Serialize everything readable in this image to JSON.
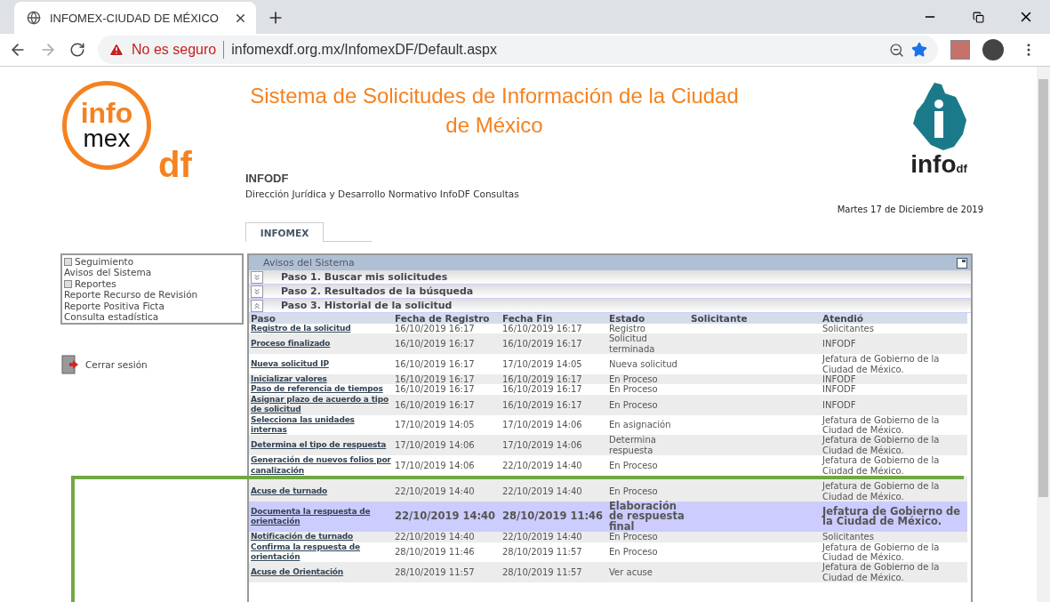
{
  "browser": {
    "tab_title": "INFOMEX-CIUDAD DE MÉXICO",
    "security_label": "No es seguro",
    "url": "infomexdf.org.mx/InfomexDF/Default.aspx"
  },
  "header": {
    "logo_left": {
      "top": "info",
      "middle": "mex",
      "bottom": "df"
    },
    "title": "Sistema de Solicitudes de Información de la Ciudad de México",
    "org": "INFODF",
    "department": "Dirección Jurídica y Desarrollo Normativo InfoDF Consultas",
    "logo_right": {
      "word": "info",
      "suffix": "df"
    },
    "date": "Martes 17 de Diciembre de 2019"
  },
  "tabs": [
    {
      "label": "INFOMEX",
      "selected": true
    }
  ],
  "sidebar": {
    "items": [
      {
        "label": "Seguimiento",
        "kind": "group"
      },
      {
        "label": "Avisos del Sistema",
        "kind": "link"
      },
      {
        "label": "Reportes",
        "kind": "group"
      },
      {
        "label": "Reporte Recurso de Revisión",
        "kind": "link"
      },
      {
        "label": "Reporte Positiva Ficta",
        "kind": "link"
      },
      {
        "label": "Consulta estadística",
        "kind": "link"
      }
    ],
    "logout": "Cerrar sesión"
  },
  "panel": {
    "title": "Avisos del Sistema",
    "steps": [
      {
        "label": "Paso 1. Buscar mis solicitudes",
        "expanded": false
      },
      {
        "label": "Paso 2. Resultados de la búsqueda",
        "expanded": false
      },
      {
        "label": "Paso 3. Historial de la solicitud",
        "expanded": true
      }
    ],
    "table": {
      "columns": [
        "Paso",
        "Fecha de Registro",
        "Fecha Fin",
        "Estado",
        "Solicitante",
        "Atendió"
      ],
      "rows": [
        {
          "paso": "Registro de la solicitud",
          "registro": "16/10/2019 16:17",
          "fin": "16/10/2019 16:17",
          "estado": "Registro",
          "atendio": "Solicitantes",
          "selected": false,
          "frame_start": false
        },
        {
          "paso": "Proceso finalizado",
          "registro": "16/10/2019 16:17",
          "fin": "16/10/2019 16:17",
          "estado": "Solicitud terminada",
          "atendio": "INFODF",
          "selected": false,
          "frame_start": false
        },
        {
          "paso": "Nueva solicitud IP",
          "registro": "16/10/2019 16:17",
          "fin": "17/10/2019 14:05",
          "estado": "Nueva solicitud",
          "atendio": "Jefatura de Gobierno de la Ciudad de México.",
          "selected": false,
          "frame_start": false
        },
        {
          "paso": "Inicializar valores",
          "registro": "16/10/2019 16:17",
          "fin": "16/10/2019 16:17",
          "estado": "En Proceso",
          "atendio": "INFODF",
          "selected": false,
          "frame_start": false
        },
        {
          "paso": "Paso de referencia de tiempos",
          "registro": "16/10/2019 16:17",
          "fin": "16/10/2019 16:17",
          "estado": "En Proceso",
          "atendio": "INFODF",
          "selected": false,
          "frame_start": false
        },
        {
          "paso": "Asignar plazo de acuerdo a tipo de solicitud",
          "registro": "16/10/2019 16:17",
          "fin": "16/10/2019 16:17",
          "estado": "En Proceso",
          "atendio": "INFODF",
          "selected": false,
          "frame_start": false
        },
        {
          "paso": "Selecciona las unidades internas",
          "registro": "17/10/2019 14:05",
          "fin": "17/10/2019 14:06",
          "estado": "En asignación",
          "atendio": "Jefatura de Gobierno de la Ciudad de México.",
          "selected": false,
          "frame_start": false
        },
        {
          "paso": "Determina el tipo de respuesta",
          "registro": "17/10/2019 14:06",
          "fin": "17/10/2019 14:06",
          "estado": "Determina respuesta",
          "atendio": "Jefatura de Gobierno de la Ciudad de México.",
          "selected": false,
          "frame_start": false
        },
        {
          "paso": "Generación de nuevos folios por canalización",
          "registro": "17/10/2019 14:06",
          "fin": "22/10/2019 14:40",
          "estado": "En Proceso",
          "atendio": "Jefatura de Gobierno de la Ciudad de México.",
          "selected": false,
          "frame_start": false
        },
        {
          "paso": "Acuse de turnado",
          "registro": "22/10/2019 14:40",
          "fin": "22/10/2019 14:40",
          "estado": "En Proceso",
          "atendio": "Jefatura de Gobierno de la Ciudad de México.",
          "selected": false,
          "frame_start": true
        },
        {
          "paso": "Documenta la respuesta de orientación",
          "registro": "22/10/2019 14:40",
          "fin": "28/10/2019 11:46",
          "estado": "Elaboración de respuesta final",
          "atendio": "Jefatura de Gobierno de la Ciudad de México.",
          "selected": true,
          "frame_start": false
        },
        {
          "paso": "Notificación de turnado",
          "registro": "22/10/2019 14:40",
          "fin": "22/10/2019 14:40",
          "estado": "En Proceso",
          "atendio": "Solicitantes",
          "selected": false,
          "frame_start": false
        },
        {
          "paso": "Confirma la respuesta de orientación",
          "registro": "28/10/2019 11:46",
          "fin": "28/10/2019 11:57",
          "estado": "En Proceso",
          "atendio": "Jefatura de Gobierno de la Ciudad de México.",
          "selected": false,
          "frame_start": false
        },
        {
          "paso": "Acuse de Orientación",
          "registro": "28/10/2019 11:57",
          "fin": "28/10/2019 11:57",
          "estado": "Ver acuse",
          "atendio": "Jefatura de Gobierno de la Ciudad de México.",
          "selected": false,
          "frame_start": false
        }
      ]
    }
  }
}
